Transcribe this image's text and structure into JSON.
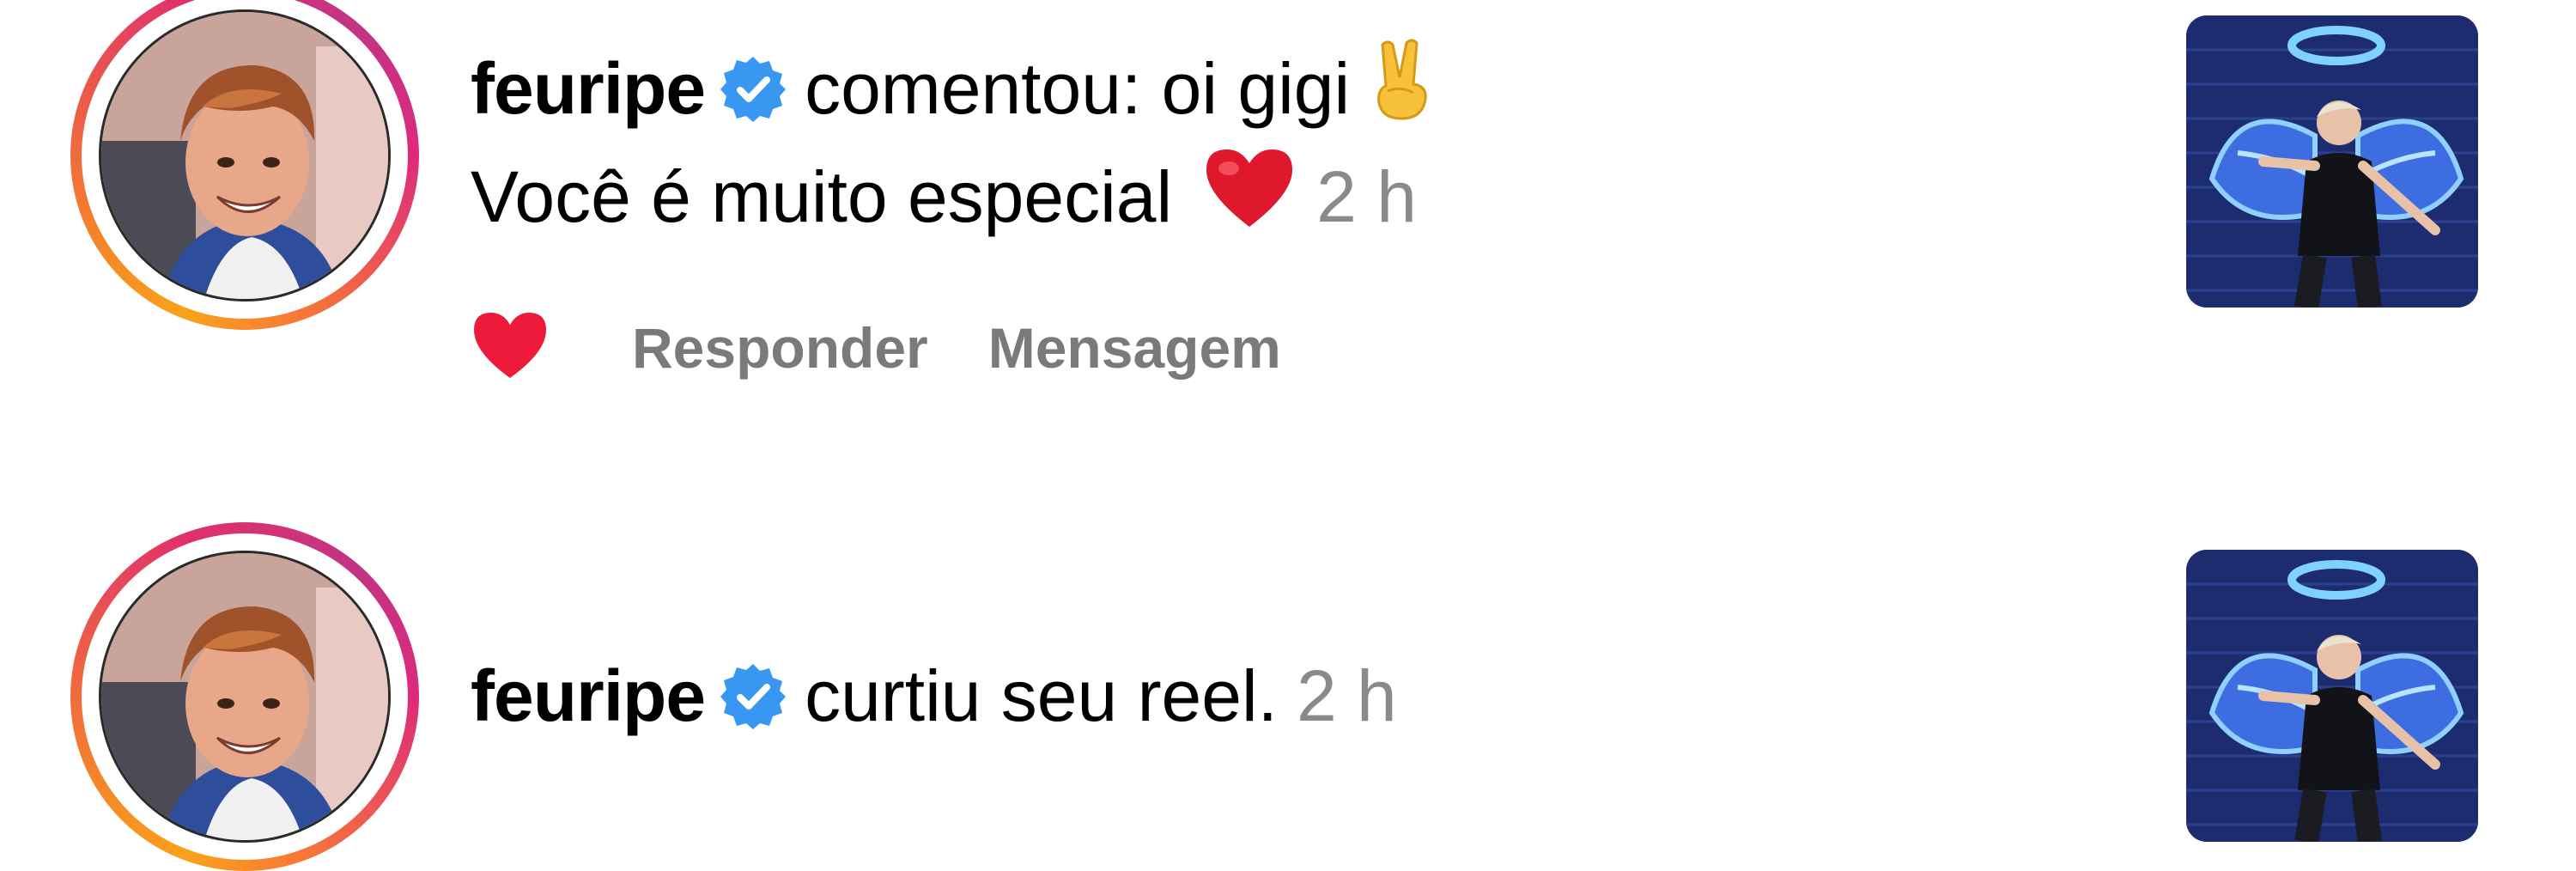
{
  "notifications": [
    {
      "username": "feuripe",
      "verified": true,
      "action_text": "comentou: oi gigi",
      "action_emoji": "✌️",
      "comment_line2": "Você é muito especial",
      "comment_line2_emoji": "❤️",
      "time": "2 h",
      "actions": {
        "like_icon": "heart-icon",
        "reply_label": "Responder",
        "message_label": "Mensagem"
      }
    },
    {
      "username": "feuripe",
      "verified": true,
      "action_text": "curtiu seu reel.",
      "time": "2 h"
    }
  ],
  "colors": {
    "verified_badge": "#3897f0",
    "like_heart": "#ed1a3c",
    "secondary_text": "#8a8a8a"
  }
}
